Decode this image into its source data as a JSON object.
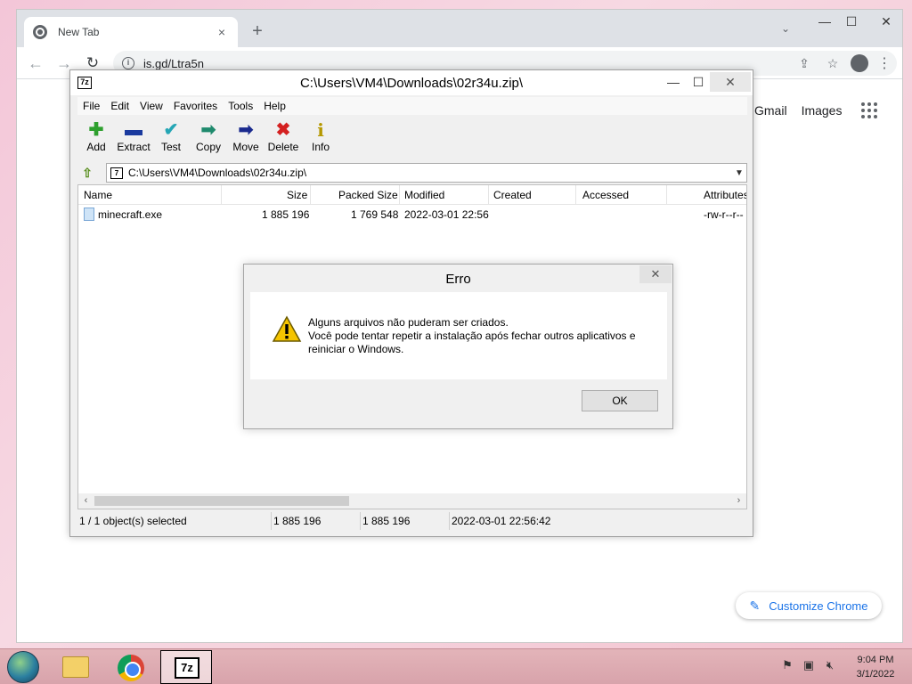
{
  "chrome": {
    "tab_title": "New Tab",
    "tab_close_glyph": "×",
    "new_tab_glyph": "+",
    "url": "is.gd/Ltra5n",
    "ntp_links": [
      "Gmail",
      "Images"
    ],
    "customize_label": "Customize Chrome"
  },
  "sevenzip": {
    "title": "C:\\Users\\VM4\\Downloads\\02r34u.zip\\",
    "menu": [
      "File",
      "Edit",
      "View",
      "Favorites",
      "Tools",
      "Help"
    ],
    "toolbar": [
      {
        "label": "Add",
        "icon": "plus-icon",
        "glyph": "✚",
        "color": "#2ea02e"
      },
      {
        "label": "Extract",
        "icon": "minus-icon",
        "glyph": "▬",
        "color": "#1a3a9e"
      },
      {
        "label": "Test",
        "icon": "check-icon",
        "glyph": "✔",
        "color": "#25a6b5"
      },
      {
        "label": "Copy",
        "icon": "copy-arrow-icon",
        "glyph": "➡",
        "color": "#1f8a6d"
      },
      {
        "label": "Move",
        "icon": "move-arrow-icon",
        "glyph": "➡",
        "color": "#1a2a8e"
      },
      {
        "label": "Delete",
        "icon": "delete-x-icon",
        "glyph": "✖",
        "color": "#d42020"
      },
      {
        "label": "Info",
        "icon": "info-icon",
        "glyph": "i",
        "color": "#b59800"
      }
    ],
    "address": "C:\\Users\\VM4\\Downloads\\02r34u.zip\\",
    "columns": [
      "Name",
      "Size",
      "Packed Size",
      "Modified",
      "Created",
      "Accessed",
      "Attributes"
    ],
    "rows": [
      {
        "name": "minecraft.exe",
        "size": "1 885 196",
        "packed": "1 769 548",
        "modified": "2022-03-01 22:56",
        "created": "",
        "accessed": "",
        "attributes": "-rw-r--r--"
      }
    ],
    "status": {
      "selected": "1 / 1 object(s) selected",
      "size": "1 885 196",
      "packed": "1 885 196",
      "modified": "2022-03-01 22:56:42"
    }
  },
  "dialog": {
    "title": "Erro",
    "line1": "Alguns arquivos não puderam ser criados.",
    "line2": "Você pode tentar repetir a instalação após fechar outros aplicativos e reiniciar o Windows.",
    "ok_label": "OK"
  },
  "taskbar": {
    "time": "9:04 PM",
    "date": "3/1/2022"
  }
}
